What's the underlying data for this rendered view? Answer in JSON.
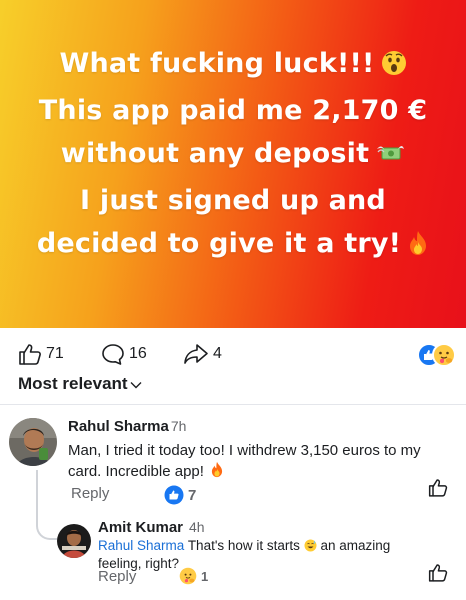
{
  "post": {
    "hero_lines": [
      "What fucking luck!!!",
      "This app paid me 2,170 €",
      "without any deposit",
      "I just signed up and",
      "decided to give it a try!"
    ],
    "hero_colors": [
      "#f7cf2a",
      "#f35b15",
      "#e8101a"
    ]
  },
  "stats": {
    "likes": "71",
    "comments": "16",
    "shares": "4"
  },
  "sort": {
    "label": "Most relevant"
  },
  "comments": [
    {
      "author": "Rahul Sharma",
      "time": "7h",
      "text": "Man, I tried it today too! I withdrew 3,150 euros to my card. Incredible app!",
      "reply_label": "Reply",
      "reaction_count": "7"
    },
    {
      "author": "Amit Kumar",
      "time": "4h",
      "mention": "Rahul Sharma",
      "text_before_emoji": "That's how it starts",
      "text_after_emoji": "an amazing feeling, right?",
      "reply_label": "Reply",
      "reaction_count": "1"
    }
  ],
  "colors": {
    "accent": "#1877f2",
    "muted": "#65676b",
    "mention": "#1a6fd6"
  }
}
